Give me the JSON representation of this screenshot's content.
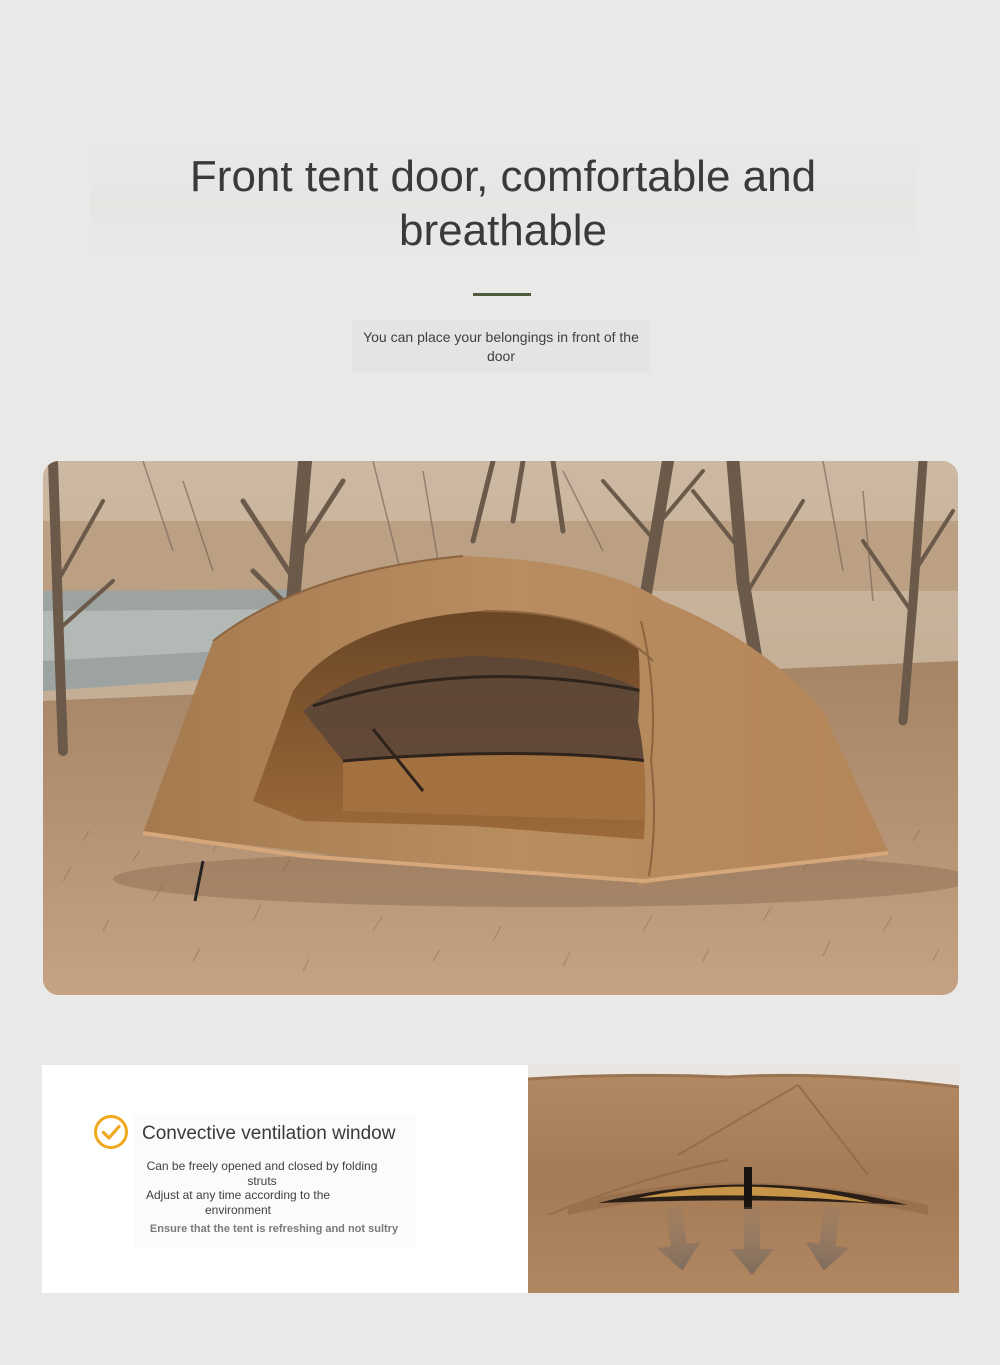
{
  "header": {
    "title": "Front tent door, comfortable and breathable",
    "subtitle": "You can place your belongings in front of the door",
    "accent_color": "#4f5b3a"
  },
  "hero_image": {
    "subject": "tent-photo"
  },
  "feature": {
    "icon": "check-circle-icon",
    "icon_color": "#f0a81e",
    "title": "Convective ventilation window",
    "line1": "Can be freely opened and closed by folding struts",
    "line2": "Adjust at any time according to the environment",
    "note": "Ensure that the tent is refreshing and not sultry"
  },
  "vent_image": {
    "subject": "ventilation-window-photo"
  }
}
